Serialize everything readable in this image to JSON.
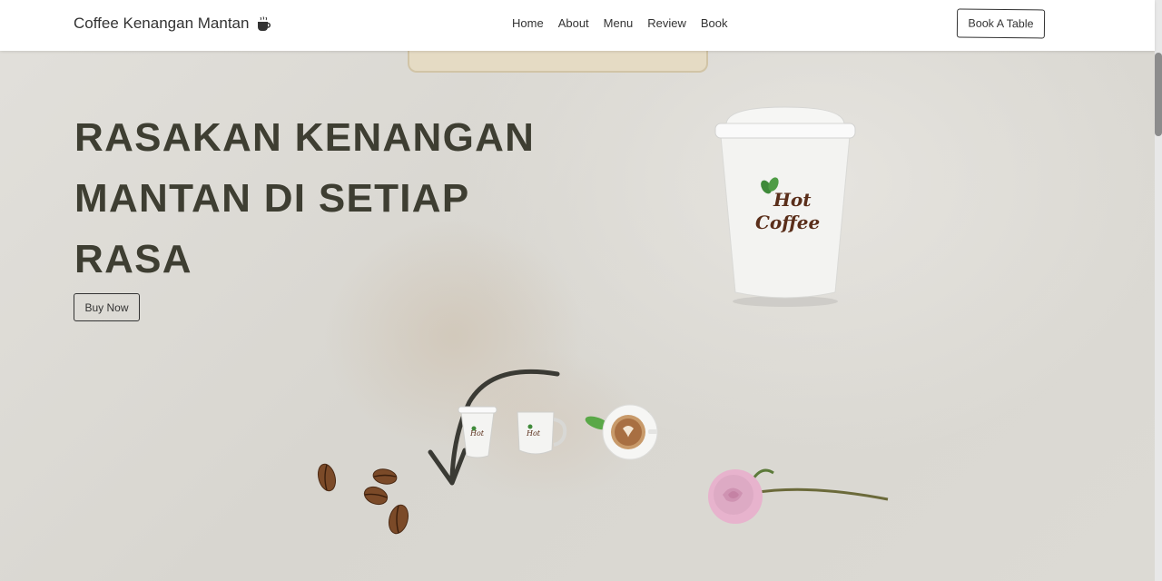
{
  "header": {
    "brand": "Coffee Kenangan Mantan",
    "brand_icon": "coffee-cup-icon",
    "nav": [
      "Home",
      "About",
      "Menu",
      "Review",
      "Book"
    ],
    "cta": "Book A Table"
  },
  "hero": {
    "headline_lines": [
      "RASAKAN KENANGAN",
      "MANTAN DI SETIAP",
      "RASA"
    ],
    "button": "Buy Now",
    "cup_logo_line1": "Hot",
    "cup_logo_line2": "Coffee"
  },
  "colors": {
    "headline": "#3e3e32",
    "logo_text": "#5a2e1a",
    "leaf": "#3f8a3a",
    "background": "#dcdad5"
  },
  "thumbnails": [
    "paper-cup",
    "mug",
    "latte-cup"
  ]
}
